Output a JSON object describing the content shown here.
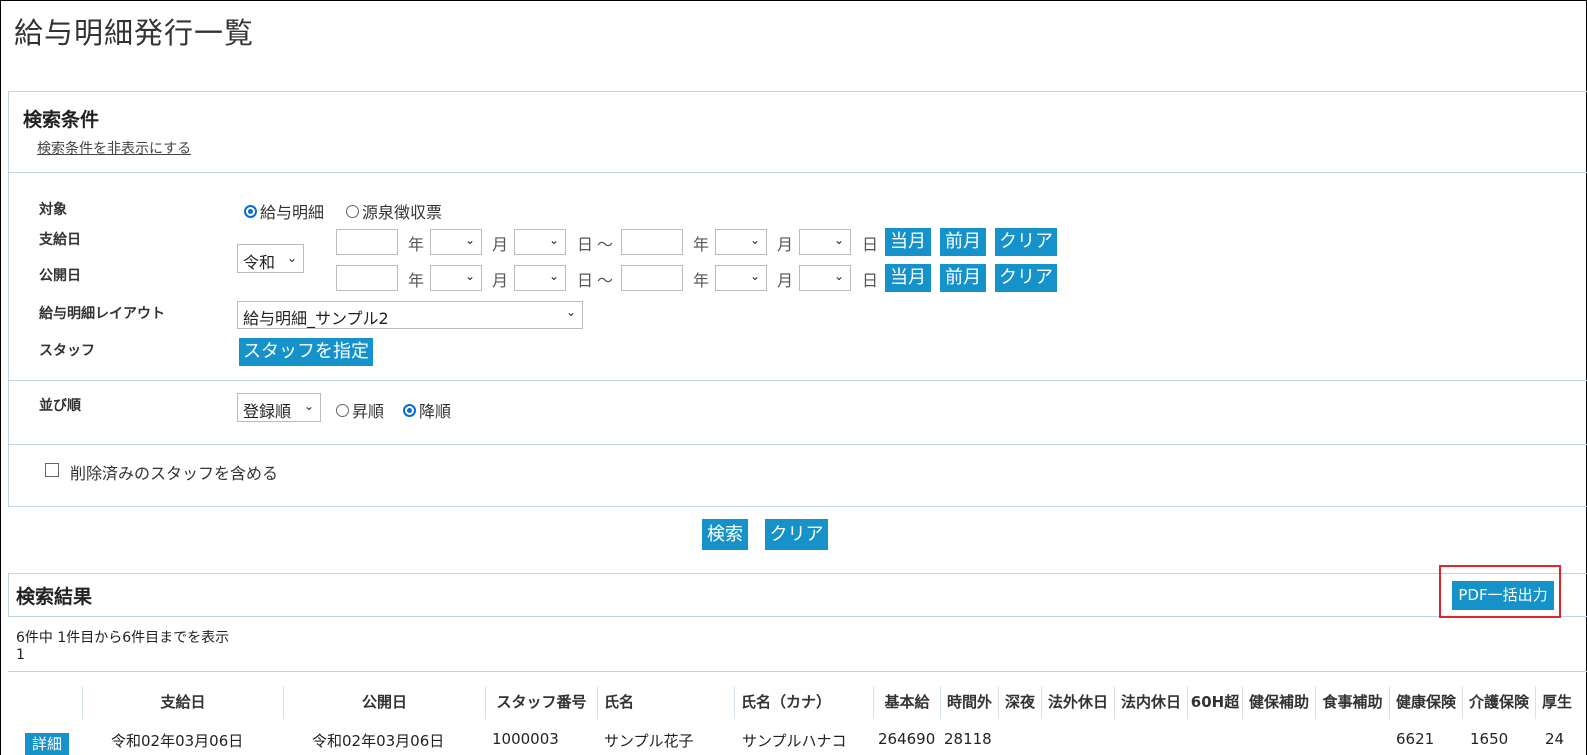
{
  "page": {
    "title": "給与明細発行一覧"
  },
  "search": {
    "title": "検索条件",
    "toggle_link": "検索条件を非表示にする",
    "target": {
      "label": "対象",
      "options": [
        "給与明細",
        "源泉徴収票"
      ],
      "selected": "給与明細"
    },
    "era": {
      "value": "令和"
    },
    "pay_date": {
      "label": "支給日"
    },
    "publish_date": {
      "label": "公開日"
    },
    "units": {
      "year": "年",
      "month": "月",
      "day": "日",
      "tilde": "〜"
    },
    "date_buttons": {
      "current": "当月",
      "previous": "前月",
      "clear": "クリア"
    },
    "layout": {
      "label": "給与明細レイアウト",
      "value": "給与明細_サンプル2"
    },
    "staff": {
      "label": "スタッフ",
      "button": "スタッフを指定"
    },
    "sort": {
      "label": "並び順",
      "value": "登録順",
      "options": [
        "昇順",
        "降順"
      ],
      "selected": "降順"
    },
    "include_deleted": {
      "label": "削除済みのスタッフを含める",
      "checked": false
    },
    "search_button": "検索",
    "clear_button": "クリア"
  },
  "results": {
    "title": "検索結果",
    "pdf_button": "PDF一括出力",
    "count_text": "6件中 1件目から6件目までを表示",
    "page": "1",
    "columns": [
      "支給日",
      "公開日",
      "スタッフ番号",
      "氏名",
      "氏名（カナ）",
      "基本給",
      "時間外",
      "深夜",
      "法外休日",
      "法内休日",
      "60H超",
      "健保補助",
      "食事補助",
      "健康保険",
      "介護保険",
      "厚生"
    ],
    "first_row": {
      "detail": "詳細",
      "pay_date": "令和02年03月06日",
      "publish_date": "令和02年03月06日",
      "staff_no": "1000003",
      "name": "サンプル花子",
      "kana": "サンプルハナコ",
      "base": "264690",
      "overtime": "28118",
      "health": "6621",
      "care": "1650",
      "pension": "24"
    }
  },
  "colors": {
    "accent": "#1592c9",
    "highlight": "#e0262a",
    "border": "#bcd6e6"
  }
}
